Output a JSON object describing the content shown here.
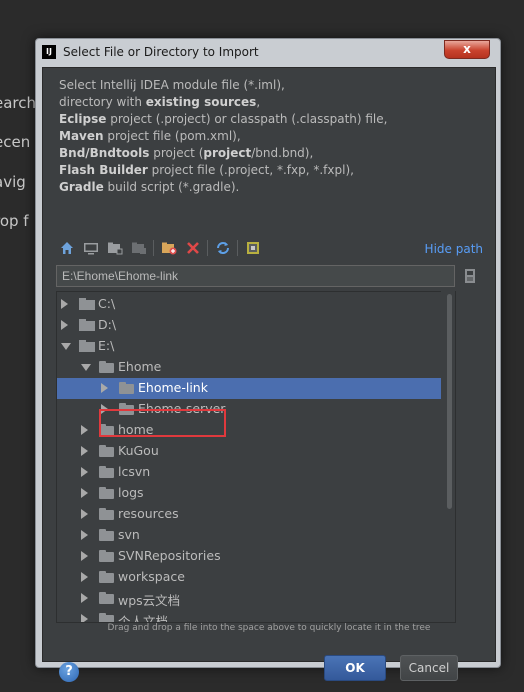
{
  "background": {
    "fragments": [
      "earch",
      "ecen",
      "avig",
      "rop f"
    ]
  },
  "dialog": {
    "title": "Select File or Directory to Import",
    "app_icon_text": "IJ",
    "close_label": "x",
    "description": [
      {
        "parts": [
          {
            "text": "Select Intellij IDEA module file (*.iml),",
            "bold": false
          }
        ]
      },
      {
        "parts": [
          {
            "text": "directory with ",
            "bold": false
          },
          {
            "text": "existing sources",
            "bold": true
          },
          {
            "text": ",",
            "bold": false
          }
        ]
      },
      {
        "parts": [
          {
            "text": "Eclipse",
            "bold": true
          },
          {
            "text": " project (.project) or classpath (.classpath) file,",
            "bold": false
          }
        ]
      },
      {
        "parts": [
          {
            "text": "Maven",
            "bold": true
          },
          {
            "text": " project file (pom.xml),",
            "bold": false
          }
        ]
      },
      {
        "parts": [
          {
            "text": "Bnd/Bndtools",
            "bold": true
          },
          {
            "text": " project (",
            "bold": false
          },
          {
            "text": "project",
            "bold": true
          },
          {
            "text": "/bnd.bnd),",
            "bold": false
          }
        ]
      },
      {
        "parts": [
          {
            "text": "Flash Builder",
            "bold": true
          },
          {
            "text": " project file (.project, *.fxp, *.fxpl),",
            "bold": false
          }
        ]
      },
      {
        "parts": [
          {
            "text": "Gradle",
            "bold": true
          },
          {
            "text": " build script (*.gradle).",
            "bold": false
          }
        ]
      }
    ],
    "toolbar": {
      "icons": [
        "home-icon",
        "desktop-icon",
        "project-icon",
        "module-icon",
        "new-folder-icon",
        "delete-icon",
        "refresh-icon",
        "show-hidden-icon"
      ],
      "hide_path_label": "Hide path"
    },
    "path_value": "E:\\Ehome\\Ehome-link",
    "tree": [
      {
        "label": "C:\\",
        "level": 0,
        "expanded": false,
        "kind": "drive",
        "selected": false
      },
      {
        "label": "D:\\",
        "level": 0,
        "expanded": false,
        "kind": "drive",
        "selected": false
      },
      {
        "label": "E:\\",
        "level": 0,
        "expanded": true,
        "kind": "drive",
        "selected": false
      },
      {
        "label": "Ehome",
        "level": 1,
        "expanded": true,
        "kind": "folder",
        "selected": false
      },
      {
        "label": "Ehome-link",
        "level": 2,
        "expanded": false,
        "kind": "folder",
        "selected": true
      },
      {
        "label": "Ehome-server",
        "level": 2,
        "expanded": false,
        "kind": "folder",
        "selected": false
      },
      {
        "label": "home",
        "level": 1,
        "expanded": false,
        "kind": "folder",
        "selected": false
      },
      {
        "label": "KuGou",
        "level": 1,
        "expanded": false,
        "kind": "folder",
        "selected": false
      },
      {
        "label": "lcsvn",
        "level": 1,
        "expanded": false,
        "kind": "folder",
        "selected": false
      },
      {
        "label": "logs",
        "level": 1,
        "expanded": false,
        "kind": "folder",
        "selected": false
      },
      {
        "label": "resources",
        "level": 1,
        "expanded": false,
        "kind": "folder",
        "selected": false
      },
      {
        "label": "svn",
        "level": 1,
        "expanded": false,
        "kind": "folder",
        "selected": false
      },
      {
        "label": "SVNRepositories",
        "level": 1,
        "expanded": false,
        "kind": "folder",
        "selected": false
      },
      {
        "label": "workspace",
        "level": 1,
        "expanded": false,
        "kind": "folder",
        "selected": false
      },
      {
        "label": "wps云文档",
        "level": 1,
        "expanded": false,
        "kind": "folder",
        "selected": false
      },
      {
        "label": "个人文档",
        "level": 1,
        "expanded": false,
        "kind": "folder",
        "selected": false
      }
    ],
    "hint": "Drag and drop a file into the space above to quickly locate it in the tree",
    "help_label": "?",
    "ok_label": "OK",
    "cancel_label": "Cancel"
  },
  "colors": {
    "selection": "#4b6eaf",
    "link": "#589df6",
    "highlight_box": "#e0393d"
  }
}
